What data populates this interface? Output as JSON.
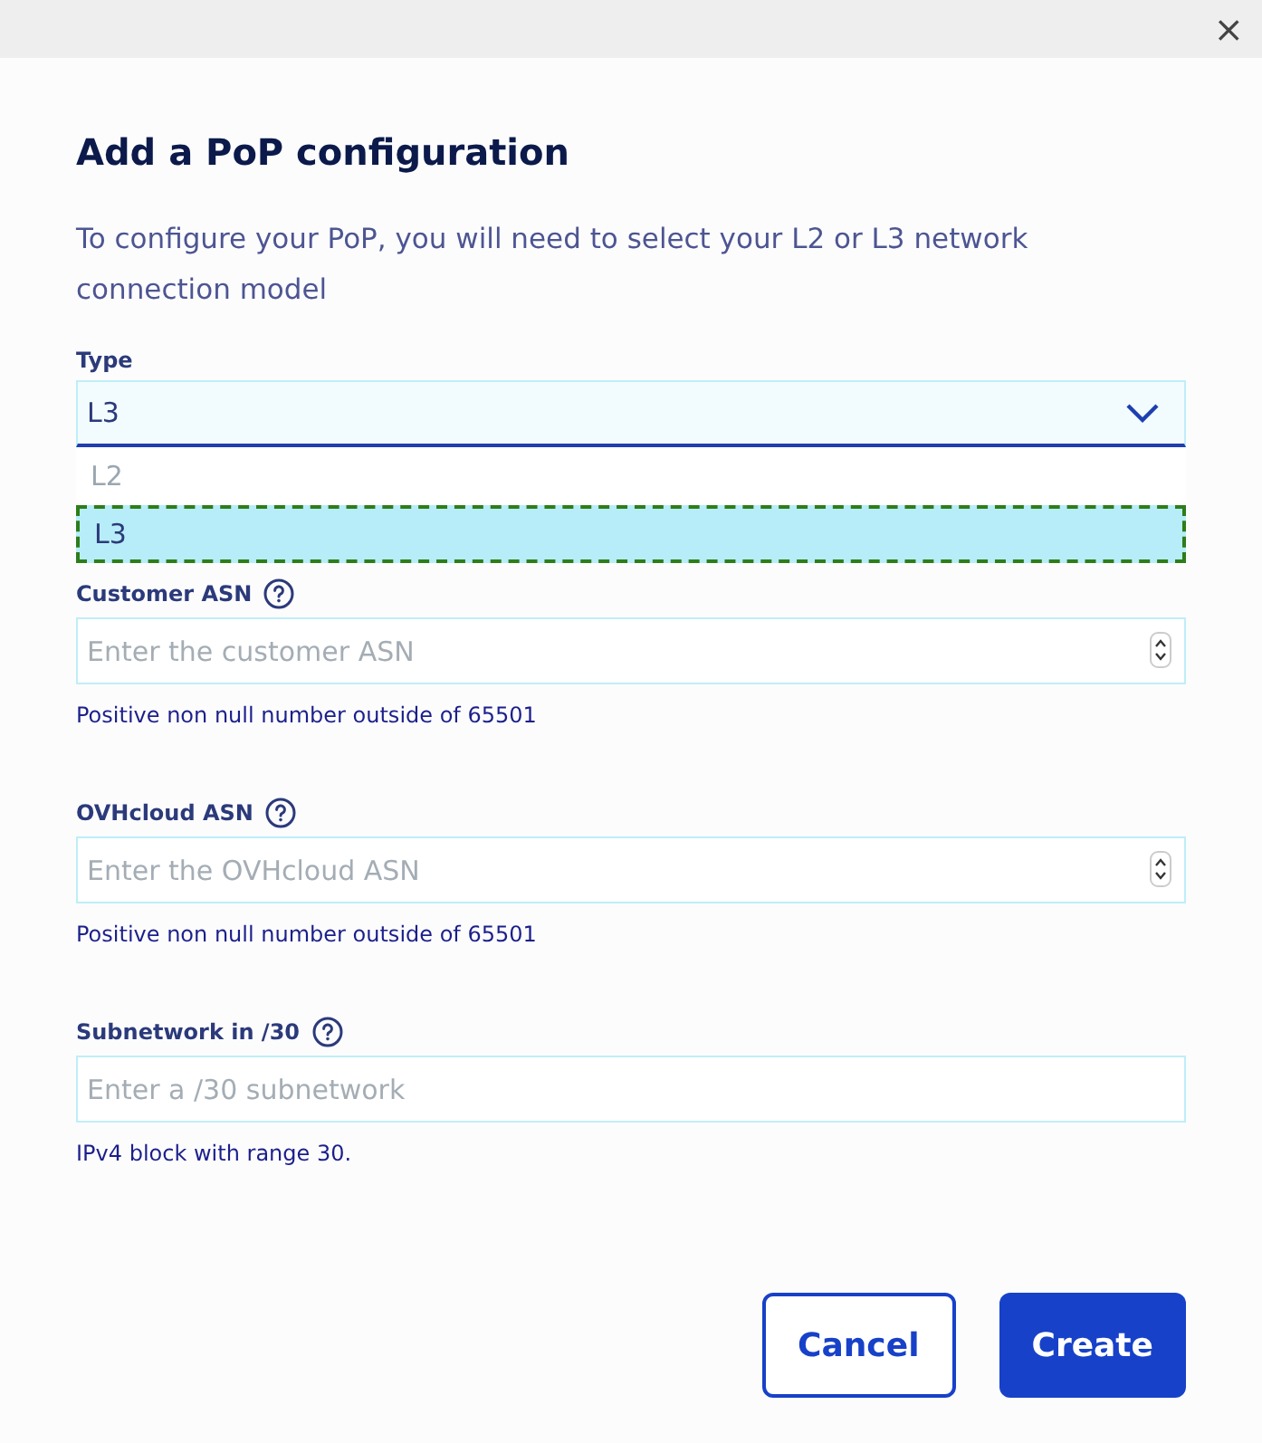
{
  "close_button": "×",
  "title": "Add a PoP configuration",
  "description": "To configure your PoP, you will need to select your L2 or L3 network connection model",
  "type_select": {
    "label": "Type",
    "value": "L3",
    "expanded": true,
    "options": [
      {
        "label": "L2",
        "selected": false
      },
      {
        "label": "L3",
        "selected": true
      }
    ]
  },
  "fields": [
    {
      "label": "Customer ASN",
      "placeholder": "Enter the customer ASN",
      "kind": "number",
      "hint": "Positive non null number outside of 65501"
    },
    {
      "label": "OVHcloud ASN",
      "placeholder": "Enter the OVHcloud ASN",
      "kind": "number",
      "hint": "Positive non null number outside of 65501"
    },
    {
      "label": "Subnetwork in /30",
      "placeholder": "Enter a /30 subnetwork",
      "kind": "text",
      "hint": "IPv4 block with range 30."
    }
  ],
  "buttons": [
    {
      "label": "Cancel",
      "kind": "secondary"
    },
    {
      "label": "Create",
      "kind": "primary"
    }
  ]
}
